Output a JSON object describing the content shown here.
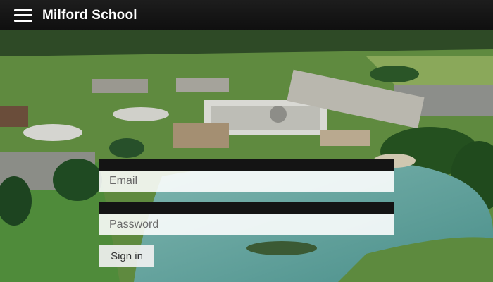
{
  "header": {
    "title": "Milford School",
    "menu_icon": "hamburger-menu-icon"
  },
  "login": {
    "email_placeholder": "Email",
    "password_placeholder": "Password",
    "signin_label": "Sign in"
  },
  "background": {
    "subject": "aerial-campus-photo"
  },
  "colors": {
    "header_bg": "#161616",
    "field_bar": "#141414",
    "field_bg": "#f2f2f2"
  }
}
